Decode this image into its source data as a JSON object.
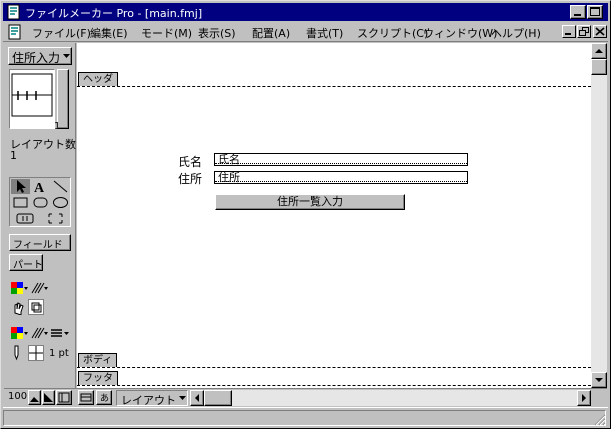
{
  "window": {
    "title": "ファイルメーカー Pro - [main.fmj]"
  },
  "menu": {
    "items": [
      "ファイル(F)",
      "編集(E)",
      "モード(M)",
      "表示(S)",
      "配置(A)",
      "書式(T)",
      "スクリプト(C)",
      "ウィンドウ(W)",
      "ヘルプ(H)"
    ]
  },
  "tools": {
    "layout_menu_label": "住所入力",
    "layout_page_number": "1",
    "layout_count_label": "レイアウト数:",
    "layout_count_value": "1",
    "field_button_label": "フィールド",
    "part_button_label": "パート",
    "line_width_label": "1 pt"
  },
  "layout": {
    "parts": [
      "ヘッダ",
      "ボディ",
      "フッタ"
    ],
    "fields": [
      {
        "label": "氏名",
        "value": "氏名"
      },
      {
        "label": "住所",
        "value": "住所"
      }
    ],
    "button_label": "住所一覧入力"
  },
  "bottom": {
    "zoom": "100",
    "mode_label": "レイアウト"
  },
  "colors": {
    "titlebar": "#000080",
    "face": "#c0c0c0",
    "canvas": "#ffffff"
  }
}
